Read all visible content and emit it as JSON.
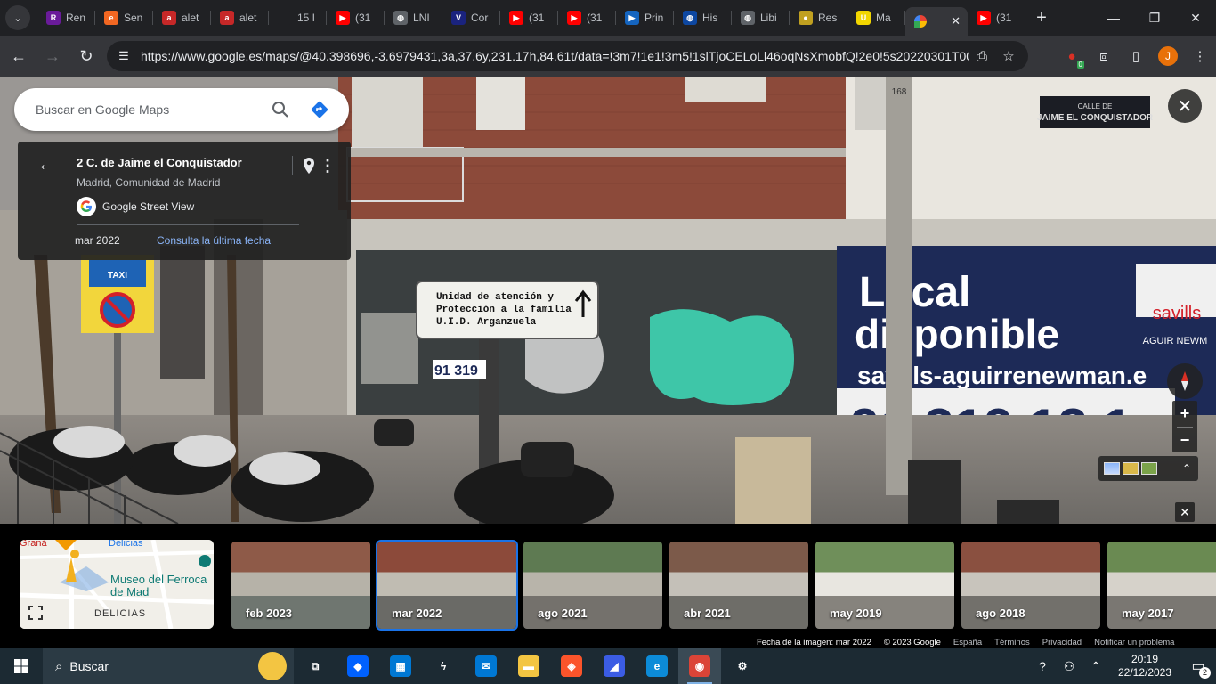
{
  "browser": {
    "tabs": [
      {
        "label": "Ren",
        "icon": "rent-icon",
        "color": "#6a1b9a",
        "glyph": "R"
      },
      {
        "label": "Sen",
        "icon": "e-letter-icon",
        "color": "#f26722",
        "glyph": "e"
      },
      {
        "label": "alet",
        "icon": "a-letter-icon",
        "color": "#c62828",
        "glyph": "a"
      },
      {
        "label": "alet",
        "icon": "a-letter-icon",
        "color": "#c62828",
        "glyph": "a"
      },
      {
        "label": "15 I",
        "icon": "dark-tab-icon",
        "color": "#202124",
        "glyph": ""
      },
      {
        "label": "(31",
        "icon": "youtube-icon",
        "color": "#ff0000",
        "glyph": "▶"
      },
      {
        "label": "LNI",
        "icon": "globe-icon",
        "color": "#5f6368",
        "glyph": "◍"
      },
      {
        "label": "Cor",
        "icon": "v-letter-icon",
        "color": "#1a237e",
        "glyph": "V"
      },
      {
        "label": "(31",
        "icon": "youtube-icon",
        "color": "#ff0000",
        "glyph": "▶"
      },
      {
        "label": "(31",
        "icon": "youtube-icon",
        "color": "#ff0000",
        "glyph": "▶"
      },
      {
        "label": "Prin",
        "icon": "play-circle-icon",
        "color": "#1565c0",
        "glyph": "▶"
      },
      {
        "label": "His",
        "icon": "globe-icon",
        "color": "#0d47a1",
        "glyph": "◍"
      },
      {
        "label": "Libi",
        "icon": "globe-icon",
        "color": "#5f6368",
        "glyph": "◍"
      },
      {
        "label": "Res",
        "icon": "pin-yellow-icon",
        "color": "#c0a020",
        "glyph": "●"
      },
      {
        "label": "Ma",
        "icon": "u-letter-icon",
        "color": "#f2d600",
        "glyph": "U"
      }
    ],
    "active_tab": {
      "icon": "google-maps-icon",
      "close": "✕"
    },
    "tail_tab": {
      "label": "(31",
      "icon": "youtube-icon",
      "color": "#ff0000",
      "glyph": "▶"
    },
    "url": "https://www.google.es/maps/@40.398696,-3.6979431,3a,37.6y,231.17h,84.61t/data=!3m7!1e1!3m5!1slTjoCELoLl46oqNsXmobfQ!2e0!5s20220301T00...",
    "extension_badge": "0",
    "profile_initial": "J"
  },
  "maps": {
    "search_placeholder": "Buscar en Google Maps",
    "card": {
      "title": "2 C. de Jaime el Conquistador",
      "subtitle": "Madrid, Comunidad de Madrid",
      "source": "Google Street View",
      "date": "mar 2022",
      "latest_link": "Consulta la última fecha"
    },
    "minimap": {
      "labels": [
        "Graná",
        "Delicias",
        "Museo del Ferroca de Mad",
        "DELICIAS"
      ]
    },
    "timeline": [
      {
        "label": "feb 2023",
        "selected": false
      },
      {
        "label": "mar 2022",
        "selected": true
      },
      {
        "label": "ago 2021",
        "selected": false
      },
      {
        "label": "abr 2021",
        "selected": false
      },
      {
        "label": "may 2019",
        "selected": false
      },
      {
        "label": "ago 2018",
        "selected": false
      },
      {
        "label": "may 2017",
        "selected": false
      }
    ],
    "attribution": {
      "image_date": "Fecha de la imagen: mar 2022",
      "copyright": "© 2023 Google",
      "country": "España",
      "terms": "Términos",
      "privacy": "Privacidad",
      "report": "Notificar un problema"
    },
    "scene_text": {
      "street_sign_1": "CALLE DE",
      "street_sign_2": "JAIME EL CONQUISTADOR",
      "post_number": "168",
      "sign_line_1": "Unidad de atención y",
      "sign_line_2": "Protección a la familia",
      "sign_line_3": "U.I.D. Arganzuela",
      "taxi": "TAXI",
      "banner_1": "Local",
      "banner_2": "disponible",
      "banner_3": "savills-aguirrenewman.e",
      "banner_4": "91 319 13 1",
      "savills": "savills",
      "aguirre": "AGUIR NEWM",
      "small_phone": "91 319"
    }
  },
  "taskbar": {
    "search_label": "Buscar",
    "apps": [
      {
        "name": "task-view-icon",
        "glyph": "⧉",
        "color": "transparent",
        "running": false
      },
      {
        "name": "dropbox-icon",
        "glyph": "◆",
        "color": "#0061fe",
        "running": false
      },
      {
        "name": "store-icon",
        "glyph": "▦",
        "color": "#0078d4",
        "running": false
      },
      {
        "name": "winamp-icon",
        "glyph": "ϟ",
        "color": "transparent",
        "running": false
      },
      {
        "name": "mail-icon",
        "glyph": "✉",
        "color": "#0078d4",
        "running": false
      },
      {
        "name": "file-explorer-icon",
        "glyph": "▬",
        "color": "#f3c542",
        "running": false
      },
      {
        "name": "brave-icon",
        "glyph": "◈",
        "color": "#fb542b",
        "running": false
      },
      {
        "name": "copilot-icon",
        "glyph": "◢",
        "color": "#3b5ce4",
        "running": false
      },
      {
        "name": "edge-icon",
        "glyph": "e",
        "color": "#0c8bd8",
        "running": false
      },
      {
        "name": "chrome-icon",
        "glyph": "◉",
        "color": "#db4437",
        "running": true
      },
      {
        "name": "settings-icon",
        "glyph": "⚙",
        "color": "transparent",
        "running": false
      }
    ],
    "clock_time": "20:19",
    "clock_date": "22/12/2023",
    "notification_count": "2"
  },
  "colors": {
    "chrome_dark": "#202124",
    "chrome_toolbar": "#35363a",
    "maps_blue": "#1a73e8",
    "link_blue": "#8ab4f8",
    "taskbar": "#1c2a33"
  }
}
